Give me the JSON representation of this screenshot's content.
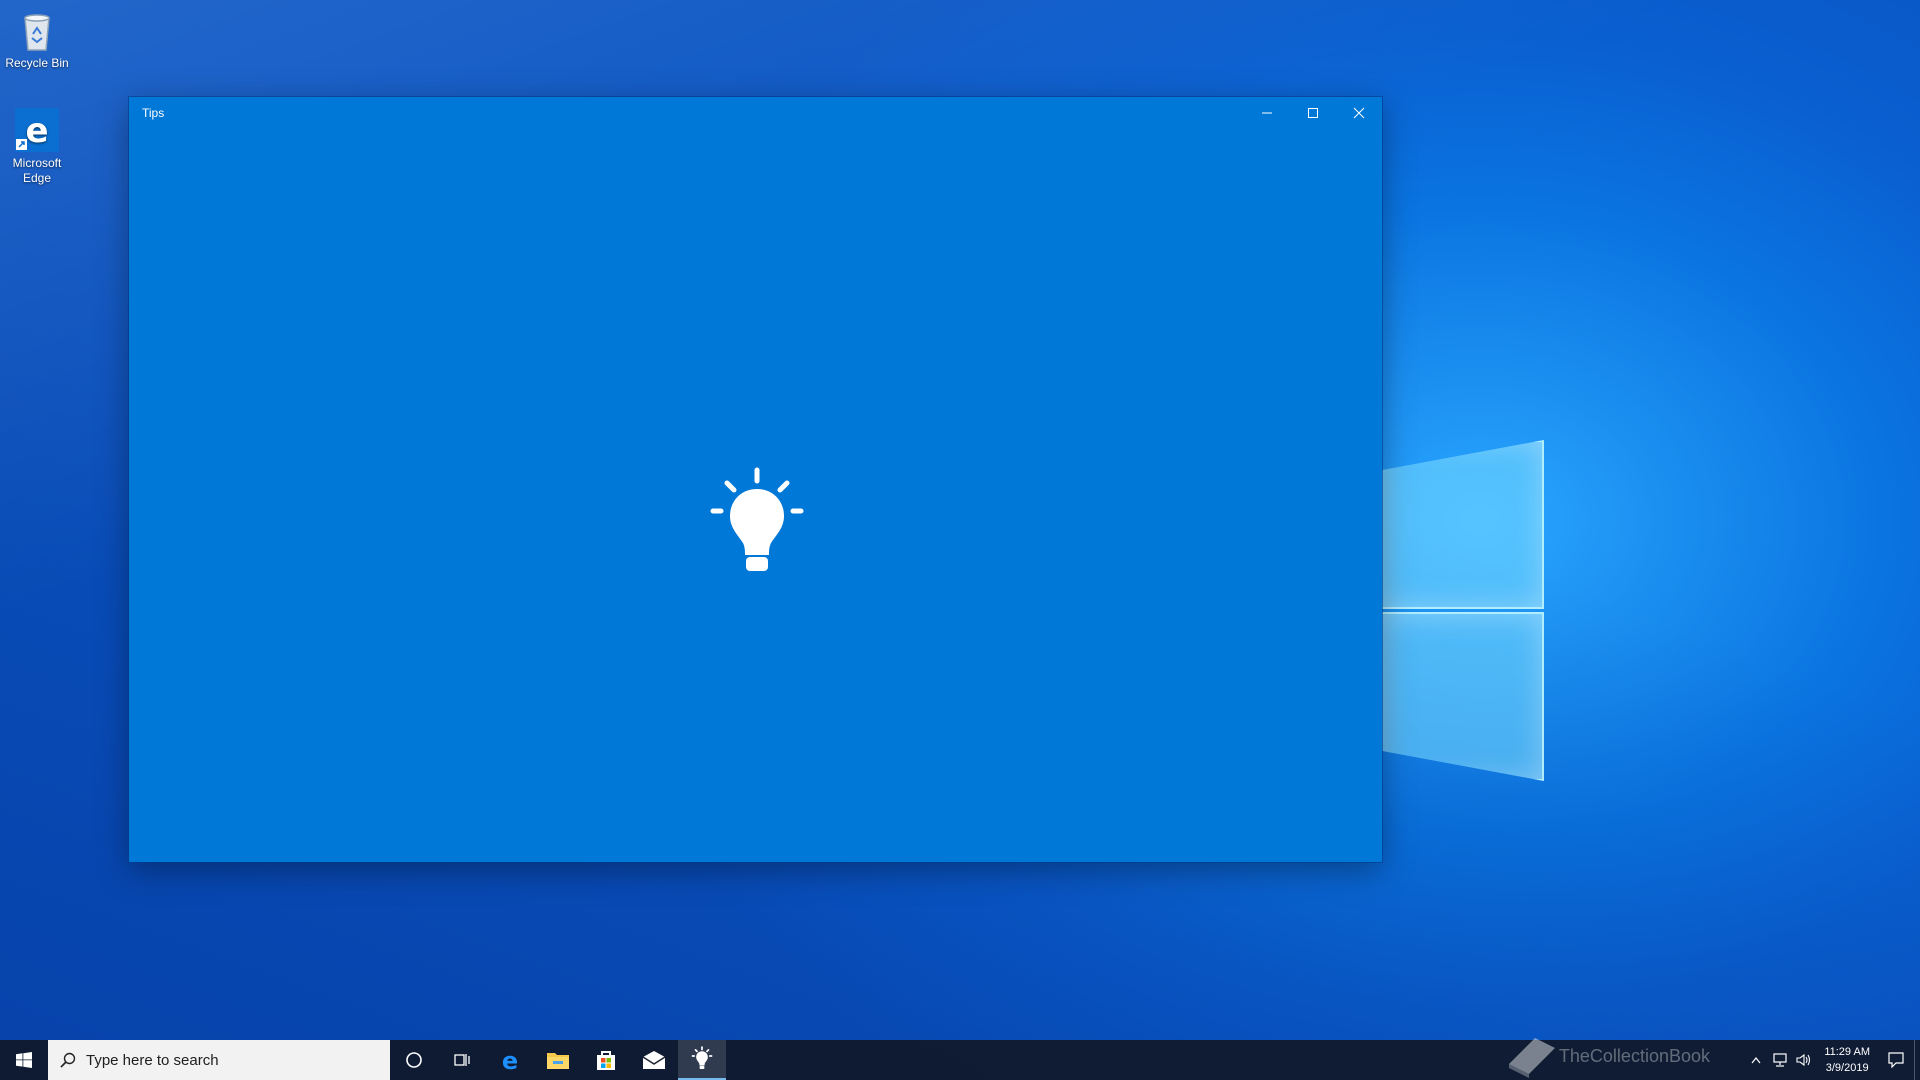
{
  "desktop": {
    "icons": [
      {
        "label": "Recycle Bin",
        "icon": "recycle-bin-icon"
      },
      {
        "label": "Microsoft Edge",
        "icon": "edge-icon"
      }
    ]
  },
  "window": {
    "title": "Tips",
    "controls": [
      "minimize",
      "maximize",
      "close"
    ],
    "background_color": "#0078d7",
    "splash_icon": "lightbulb-icon"
  },
  "taskbar": {
    "search_placeholder": "Type here to search",
    "pinned": [
      "cortana-icon",
      "task-view-icon",
      "edge-icon",
      "file-explorer-icon",
      "store-icon",
      "mail-icon",
      "tips-icon"
    ],
    "active_app": "tips-icon",
    "clock": {
      "time": "11:29 AM",
      "date": "3/9/2019"
    },
    "watermark": "TheCollectionBook"
  }
}
